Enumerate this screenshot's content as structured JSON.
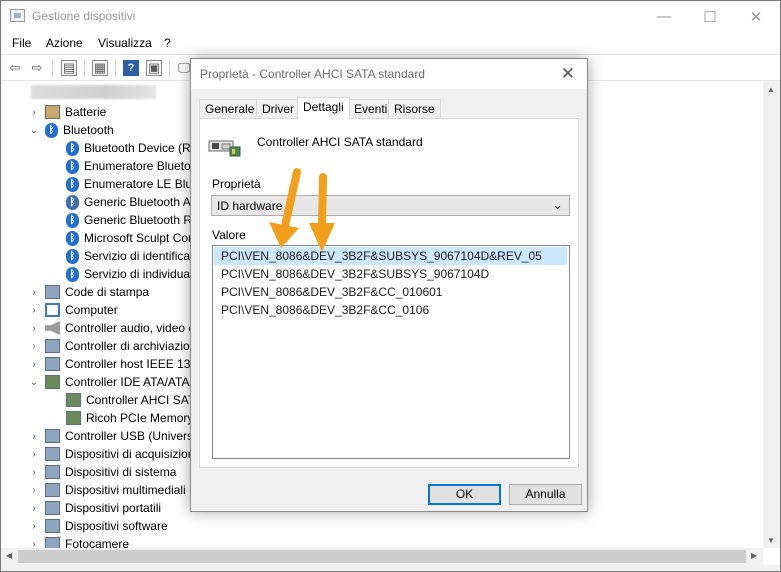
{
  "window": {
    "title": "Gestione dispositivi",
    "controls": {
      "minimize": "—",
      "maximize": "☐",
      "close": "✕"
    }
  },
  "menu": [
    {
      "label": "File"
    },
    {
      "label": "Azione"
    },
    {
      "label": "Visualizza"
    },
    {
      "label": "?"
    }
  ],
  "toolbar": {
    "icons": [
      "back-arrow-icon",
      "forward-arrow-icon",
      "show-hide-tree-icon",
      "properties-icon",
      "help-icon",
      "action-pane-icon",
      "scan-hardware-icon"
    ],
    "help_label": "?"
  },
  "tree": {
    "items": [
      {
        "label": "Batterie",
        "chevron": "›",
        "icon": "battery-icon"
      },
      {
        "label": "Bluetooth",
        "chevron": "⌄",
        "icon": "bluetooth-icon"
      },
      {
        "label": "Bluetooth Device (RF"
      },
      {
        "label": "Enumeratore Bluetoo"
      },
      {
        "label": "Enumeratore LE Blue"
      },
      {
        "label": "Generic Bluetooth A"
      },
      {
        "label": "Generic Bluetooth Ra"
      },
      {
        "label": "Microsoft Sculpt Cor"
      },
      {
        "label": "Servizio di identificaz"
      },
      {
        "label": "Servizio di individuaz"
      },
      {
        "label": "Code di stampa"
      },
      {
        "label": "Computer"
      },
      {
        "label": "Controller audio, video e"
      },
      {
        "label": "Controller di archiviazio"
      },
      {
        "label": "Controller host IEEE 1394"
      },
      {
        "label": "Controller IDE ATA/ATAPI"
      },
      {
        "label": "Controller AHCI SATA"
      },
      {
        "label": "Ricoh PCIe Memory"
      },
      {
        "label": "Controller USB (Universa"
      },
      {
        "label": "Dispositivi di acquisizion"
      },
      {
        "label": "Dispositivi di sistema"
      },
      {
        "label": "Dispositivi multimediali"
      },
      {
        "label": "Dispositivi portatili"
      },
      {
        "label": "Dispositivi software"
      },
      {
        "label": "Fotocamere"
      }
    ]
  },
  "dialog": {
    "title": "Proprietà - Controller AHCI SATA standard",
    "close": "✕",
    "tabs": [
      "Generale",
      "Driver",
      "Dettagli",
      "Eventi",
      "Risorse"
    ],
    "active_tab": "Dettagli",
    "device_name": "Controller AHCI SATA standard",
    "property_label": "Proprietà",
    "property_value": "ID hardware",
    "value_label": "Valore",
    "values": [
      "PCI\\VEN_8086&DEV_3B2F&SUBSYS_9067104D&REV_05",
      "PCI\\VEN_8086&DEV_3B2F&SUBSYS_9067104D",
      "PCI\\VEN_8086&DEV_3B2F&CC_010601",
      "PCI\\VEN_8086&DEV_3B2F&CC_0106"
    ],
    "ok_label": "OK",
    "cancel_label": "Annulla"
  },
  "annotation": {
    "arrow_color": "#f2a01b"
  }
}
